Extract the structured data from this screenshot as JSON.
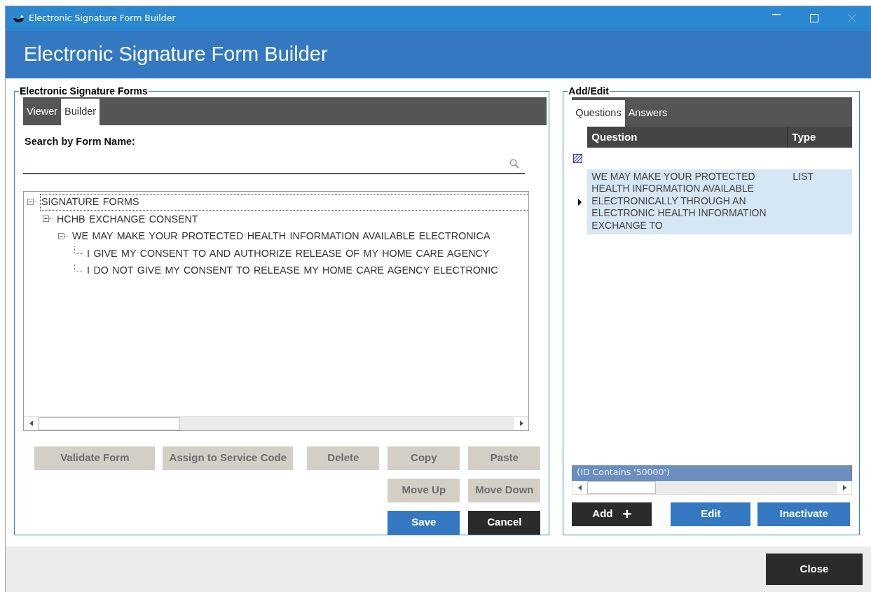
{
  "window": {
    "title": "Electronic Signature Form Builder"
  },
  "header": {
    "title": "Electronic Signature Form Builder"
  },
  "forms_panel": {
    "legend": "Electronic Signature Forms",
    "tabs": [
      {
        "label": "Viewer",
        "selected": false
      },
      {
        "label": "Builder",
        "selected": true
      }
    ],
    "search": {
      "label": "Search by Form Name:"
    },
    "tree": [
      {
        "label": "SIGNATURE FORMS",
        "expanded": true,
        "selected": true,
        "children": [
          {
            "label": "HCHB EXCHANGE CONSENT",
            "expanded": true,
            "selected": false,
            "children": [
              {
                "label": "WE MAY MAKE YOUR PROTECTED HEALTH INFORMATION AVAILABLE ELECTRONICA",
                "expanded": true,
                "selected": false,
                "children": [
                  {
                    "label": "I GIVE MY CONSENT TO AND AUTHORIZE RELEASE OF MY HOME CARE AGENCY",
                    "selected": false
                  },
                  {
                    "label": "I DO NOT GIVE MY CONSENT TO RELEASE MY HOME CARE AGENCY ELECTRONIC",
                    "selected": false
                  }
                ]
              }
            ]
          }
        ]
      }
    ],
    "button_rows": [
      [
        {
          "label": "Validate Form",
          "kind": "disabled"
        },
        {
          "label": "Assign to Service Code",
          "kind": "disabled"
        },
        {
          "label": "Delete",
          "kind": "disabled"
        },
        {
          "label": "Copy",
          "kind": "disabled"
        },
        {
          "label": "Paste",
          "kind": "disabled"
        }
      ],
      [
        {
          "label": "Move Up",
          "kind": "disabled"
        },
        {
          "label": "Move Down",
          "kind": "disabled"
        }
      ],
      [
        {
          "label": "Save",
          "kind": "primary"
        },
        {
          "label": "Cancel",
          "kind": "dark"
        }
      ]
    ]
  },
  "edit_panel": {
    "legend": "Add/Edit",
    "tabs": [
      {
        "label": "Questions",
        "selected": true
      },
      {
        "label": "Answers",
        "selected": false
      }
    ],
    "grid": {
      "columns": [
        "Question",
        "Type"
      ],
      "rows": [
        {
          "question": "WE MAY MAKE YOUR PROTECTED HEALTH INFORMATION AVAILABLE ELECTRONICALLY THROUGH AN ELECTRONIC HEALTH INFORMATION EXCHANGE TO",
          "type": "LIST",
          "selected": true
        }
      ],
      "filter": "(ID Contains '50000')"
    },
    "buttons": [
      {
        "label": "Add",
        "icon_text": "+",
        "kind": "dark"
      },
      {
        "label": "Edit",
        "kind": "primary"
      },
      {
        "label": "Inactivate",
        "kind": "primary"
      }
    ]
  },
  "footer": {
    "buttons": [
      {
        "label": "Close",
        "kind": "dark"
      }
    ]
  }
}
